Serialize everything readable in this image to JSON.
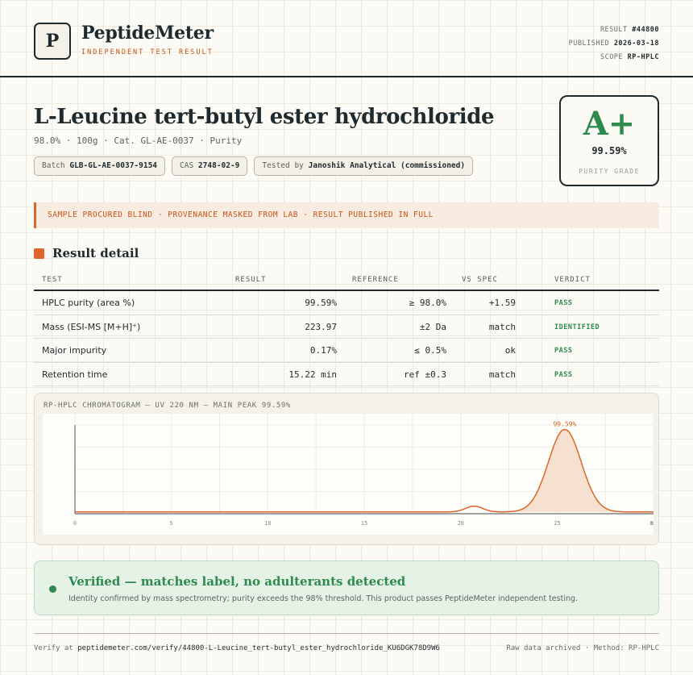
{
  "brand": {
    "logo_letter": "P",
    "name": "PeptideMeter",
    "tagline": "INDEPENDENT TEST RESULT"
  },
  "meta": {
    "result_label": "RESULT",
    "result_value": "#44800",
    "published_label": "PUBLISHED",
    "published_value": "2026-03-18",
    "scope_label": "SCOPE",
    "scope_value": "RP-HPLC"
  },
  "product": {
    "title": "L-Leucine tert-butyl ester hydrochloride",
    "subtitle": "98.0% · 100g · Cat. GL-AE-0037 · Purity"
  },
  "chips": {
    "batch_label": "Batch",
    "batch_value": "GLB-GL-AE-0037-9154",
    "cas_label": "CAS",
    "cas_value": "2748-02-9",
    "tested_label": "Tested by",
    "tested_value": "Janoshik Analytical (commissioned)"
  },
  "grade": {
    "letter": "A+",
    "value": "99.59%",
    "label": "PURITY GRADE"
  },
  "notice": "SAMPLE PROCURED BLIND · PROVENANCE MASKED FROM LAB · RESULT PUBLISHED IN FULL",
  "section_title": "Result detail",
  "table": {
    "headers": [
      "TEST",
      "RESULT",
      "REFERENCE",
      "VS SPEC",
      "VERDICT"
    ],
    "rows": [
      {
        "test": "HPLC purity (area %)",
        "result": "99.59%",
        "reference": "≥ 98.0%",
        "vs_spec": "+1.59",
        "verdict": "PASS"
      },
      {
        "test": "Mass (ESI-MS [M+H]⁺)",
        "result": "223.97",
        "reference": "±2 Da",
        "vs_spec": "match",
        "verdict": "IDENTIFIED"
      },
      {
        "test": "Major impurity",
        "result": "0.17%",
        "reference": "≤ 0.5%",
        "vs_spec": "ok",
        "verdict": "PASS"
      },
      {
        "test": "Retention time",
        "result": "15.22 min",
        "reference": "ref ±0.3",
        "vs_spec": "match",
        "verdict": "PASS"
      }
    ]
  },
  "chart_data": {
    "type": "line",
    "title": "RP-HPLC CHROMATOGRAM — UV 220 NM — MAIN PEAK 99.59%",
    "xlim": [
      0,
      30
    ],
    "ylim": [
      0,
      100
    ],
    "x_ticks": [
      "0",
      "5",
      "10",
      "15",
      "20",
      "25",
      "30",
      "min"
    ],
    "peaks": [
      {
        "center": 20.7,
        "height": 6.5,
        "width": 0.45
      },
      {
        "center": 25.4,
        "height": 93,
        "width": 0.85
      }
    ],
    "baseline": 2,
    "peak_label": "99.59%",
    "line_color": "#d8672a",
    "fill_color": "#f6e1d0",
    "grid": true
  },
  "verified": {
    "title": "Verified — matches label, no adulterants detected",
    "subtitle": "Identity confirmed by mass spectrometry; purity exceeds the 98% threshold. This product passes PeptideMeter independent testing."
  },
  "footer": {
    "verify_label": "Verify at",
    "verify_url": "peptidemeter.com/verify/44800-L-Leucine_tert-butyl_ester_hydrochloride_KU6DGK78D9W6",
    "right": "Raw data archived · Method: RP-HPLC"
  },
  "colors": {
    "accent": "#d8672a",
    "pass": "#2f8a4e",
    "ink": "#1f2a2e"
  }
}
